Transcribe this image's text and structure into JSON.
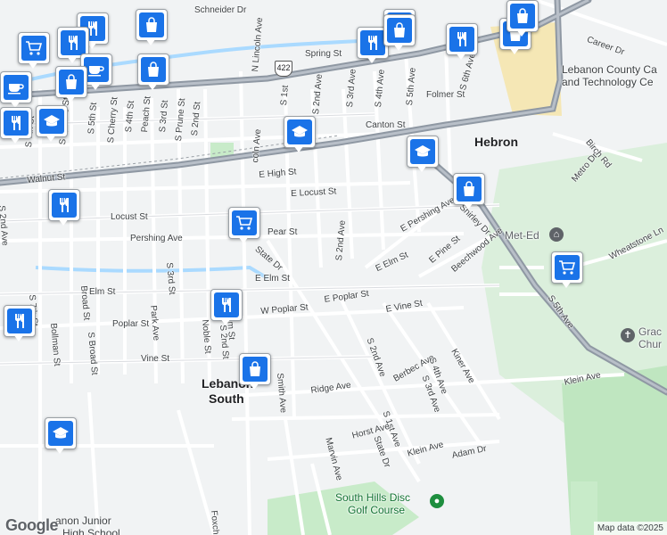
{
  "map": {
    "attribution": "Map data ©2025",
    "logo": "Google",
    "route_shield": "422",
    "places": [
      {
        "key": "hebron",
        "text": "Hebron"
      },
      {
        "key": "lebanon_south_1",
        "text": "Lebanon"
      },
      {
        "key": "lebanon_south_2",
        "text": "South"
      }
    ],
    "pois": [
      {
        "key": "ctc1",
        "text": "Lebanon County Ca"
      },
      {
        "key": "ctc2",
        "text": "and Technology Ce"
      },
      {
        "key": "meted",
        "text": "Met-Ed"
      },
      {
        "key": "grace1",
        "text": "Grac"
      },
      {
        "key": "grace2",
        "text": "Chur"
      },
      {
        "key": "golf1",
        "text": "South Hills Disc"
      },
      {
        "key": "golf2",
        "text": "Golf Course"
      },
      {
        "key": "school1",
        "text": "anon Junior"
      },
      {
        "key": "school2",
        "text": "High School"
      }
    ],
    "streets": [
      "Schneider Dr",
      "Spring St",
      "Career Dr",
      "N Lincoln Ave",
      "S 1st",
      "S 2nd Ave",
      "S 3rd Ave",
      "S 4th Ave",
      "S 5th Ave",
      "S 6th Ave",
      "Folmer St",
      "Canton St",
      "S 7th St",
      "S Quince St",
      "S 5th St",
      "S Cherry St",
      "S 4th St",
      "Peach St",
      "S 3rd St",
      "S Prune St",
      "S 2nd St",
      "Walnut St",
      "E High St",
      "Birch Rd",
      "Metro Dr",
      "E Locust St",
      "Locust St",
      "E Pershing Ave",
      "Shirley Dr",
      "Pershing Ave",
      "Pear St",
      "S 2nd Ave",
      "State Dr",
      "E Elm St",
      "E Pine St",
      "Beechwood Ave",
      "Wheatstone Ln",
      "E Elm St",
      "Elm St",
      "E Poplar St",
      "S 5th Ave",
      "Broad St",
      "S Broad St",
      "S 3rd St",
      "Park Ave",
      "Noble St",
      "S 2nd St",
      "W Poplar St",
      "Poplar St",
      "E Vine St",
      "S 7th St",
      "Bollman St",
      "Vine St",
      "Smith Ave",
      "S 2nd Ave",
      "Berbec Ave",
      "S 4th Ave",
      "S 3rd Ave",
      "Kiner Ave",
      "Klein Ave",
      "Ridge Ave",
      "S 1st Ave",
      "Horst Ave",
      "State Dr",
      "Klein Ave",
      "Adam Dr",
      "Marvin Ave",
      "Foxch",
      "S 2nd Ave",
      "coln Ave",
      "lm St",
      "M"
    ],
    "markers": [
      {
        "key": "m1",
        "icon": "restaurant-icon"
      },
      {
        "key": "m2",
        "icon": "shopping-bag-icon"
      },
      {
        "key": "m3",
        "icon": "shopping-cart-icon"
      },
      {
        "key": "m4",
        "icon": "restaurant-icon"
      },
      {
        "key": "m5",
        "icon": "cafe-icon"
      },
      {
        "key": "m6",
        "icon": "shopping-bag-icon"
      },
      {
        "key": "m7",
        "icon": "cafe-icon"
      },
      {
        "key": "m8",
        "icon": "school-icon"
      },
      {
        "key": "m9",
        "icon": "restaurant-icon"
      },
      {
        "key": "m10",
        "icon": "shopping-bag-icon"
      },
      {
        "key": "m11",
        "icon": "restaurant-icon"
      },
      {
        "key": "m12",
        "icon": "restaurant-icon"
      },
      {
        "key": "m13",
        "icon": "shopping-bag-icon"
      },
      {
        "key": "m14",
        "icon": "school-icon"
      },
      {
        "key": "m15",
        "icon": "school-icon"
      },
      {
        "key": "m16",
        "icon": "shopping-bag-icon"
      },
      {
        "key": "m17",
        "icon": "restaurant-icon"
      },
      {
        "key": "m18",
        "icon": "shopping-cart-icon"
      },
      {
        "key": "m19",
        "icon": "shopping-cart-icon"
      },
      {
        "key": "m20",
        "icon": "restaurant-icon"
      },
      {
        "key": "m21",
        "icon": "restaurant-icon"
      },
      {
        "key": "m22",
        "icon": "shopping-bag-icon"
      },
      {
        "key": "m23",
        "icon": "school-icon"
      },
      {
        "key": "m24",
        "icon": "shopping-bag-icon"
      },
      {
        "key": "m25",
        "icon": "restaurant-icon"
      },
      {
        "key": "m26",
        "icon": "shopping-bag-icon"
      }
    ],
    "colors": {
      "water": "#aadaff",
      "park": "#c8ebc9",
      "road_major": "#8f98a3",
      "road_minor": "#ffffff",
      "marker": "#1a73e8",
      "sand": "#f5e7b5"
    }
  }
}
